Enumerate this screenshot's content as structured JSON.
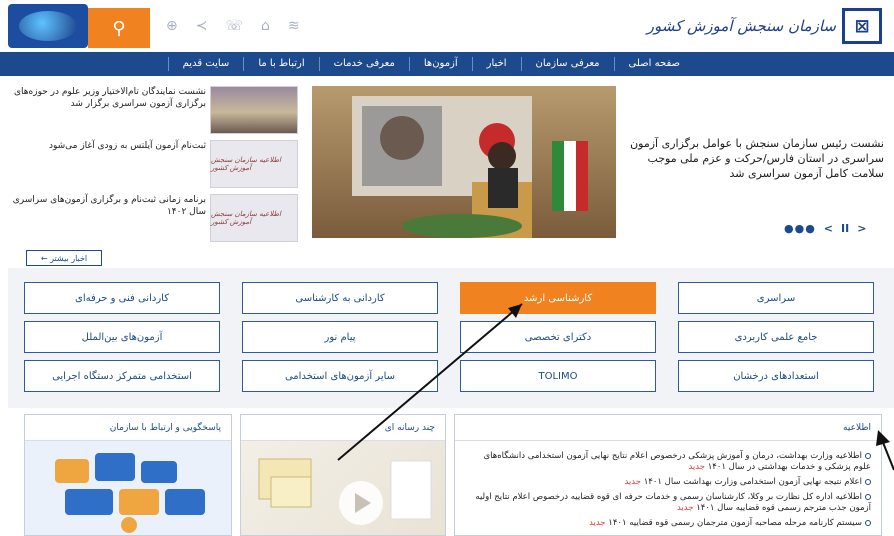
{
  "header": {
    "logo_text": "سازمان سنجش آموزش کشور",
    "logo_icon": "org-logo-icon",
    "emblem_icon": "emblem-icon",
    "icons": [
      "search-icon",
      "globe-icon",
      "share-icon",
      "phone-icon",
      "home-icon",
      "rss-icon"
    ],
    "accent": "#f0821f",
    "nav_color": "#1c4a8c"
  },
  "nav": {
    "items": [
      {
        "label": "صفحه اصلی"
      },
      {
        "label": "معرفی سازمان"
      },
      {
        "label": "اخبار"
      },
      {
        "label": "آزمون‌ها"
      },
      {
        "label": "معرفی خدمات"
      },
      {
        "label": "ارتباط با ما"
      },
      {
        "label": "سایت قدیم"
      }
    ]
  },
  "slider": {
    "caption": "نشست رئیس سازمان سنجش با عوامل برگزاری آزمون سراسری در استان فارس/حرکت و عزم ملی موجب سلامت کامل آزمون سراسری شد",
    "dots": "●●●",
    "prev": "<",
    "pause": "II",
    "next": ">"
  },
  "news": {
    "items": [
      {
        "text": "نشست نمایندگان تام‌الاختیار وزیر علوم در حوزه‌های برگزاری آزمون سراسری برگزار شد",
        "thumb": ""
      },
      {
        "text": "ثبت‌نام آزمون آیلتس به زودی آغاز می‌شود",
        "thumb": "اطلاعیه سازمان سنجش آموزش کشور"
      },
      {
        "text": "برنامه زمانی ثبت‌نام و برگزاری آزمون‌های سراسری سال ۱۴۰۲",
        "thumb": "اطلاعیه سازمان سنجش آموزش کشور"
      }
    ],
    "more_label": "اخبار بیشتر ←"
  },
  "exams": {
    "row1": [
      "سراسری",
      "کارشناسی ارشد",
      "کاردانی به کارشناسی",
      "کاردانی فنی و حرفه‌ای"
    ],
    "row2": [
      "جامع علمی کاربردی",
      "دکترای تخصصی",
      "پیام نور",
      "آزمون‌های بین‌الملل"
    ],
    "row3": [
      "استعدادهای درخشان",
      "TOLIMO",
      "سایر آزمون‌های استخدامی",
      "استخدامی متمرکز دستگاه اجرایی"
    ],
    "active": "کارشناسی ارشد"
  },
  "panels": {
    "announcements_title": "اطلاعیه",
    "announcements": [
      {
        "text": "اطلاعیه وزارت بهداشت، درمان و آموزش پزشکی درخصوص اعلام نتایج نهایی آزمون استخدامی دانشگاه‌های علوم پزشکی و خدمات بهداشتی در سال ۱۴۰۱",
        "badge": "جدید"
      },
      {
        "text": "اعلام نتیجه نهایی آزمون استخدامی وزارت بهداشت سال ۱۴۰۱",
        "badge": "جدید"
      },
      {
        "text": "اطلاعیه اداره کل نظارت بر وکلا، کارشناسان رسمی و خدمات حرفه ای قوه قضاییه درخصوص اعلام نتایج اولیه آزمون جذب مترجم رسمی قوه قضاییه سال ۱۴۰۱",
        "badge": "جدید"
      },
      {
        "text": "سیستم کارنامه مرحله مصاحبه آزمون مترجمان رسمی قوه قضاییه ۱۴۰۱",
        "badge": "جدید"
      }
    ],
    "media_title": "چند رسانه ای",
    "contact_title": "پاسخگویی و ارتباط با سازمان"
  }
}
